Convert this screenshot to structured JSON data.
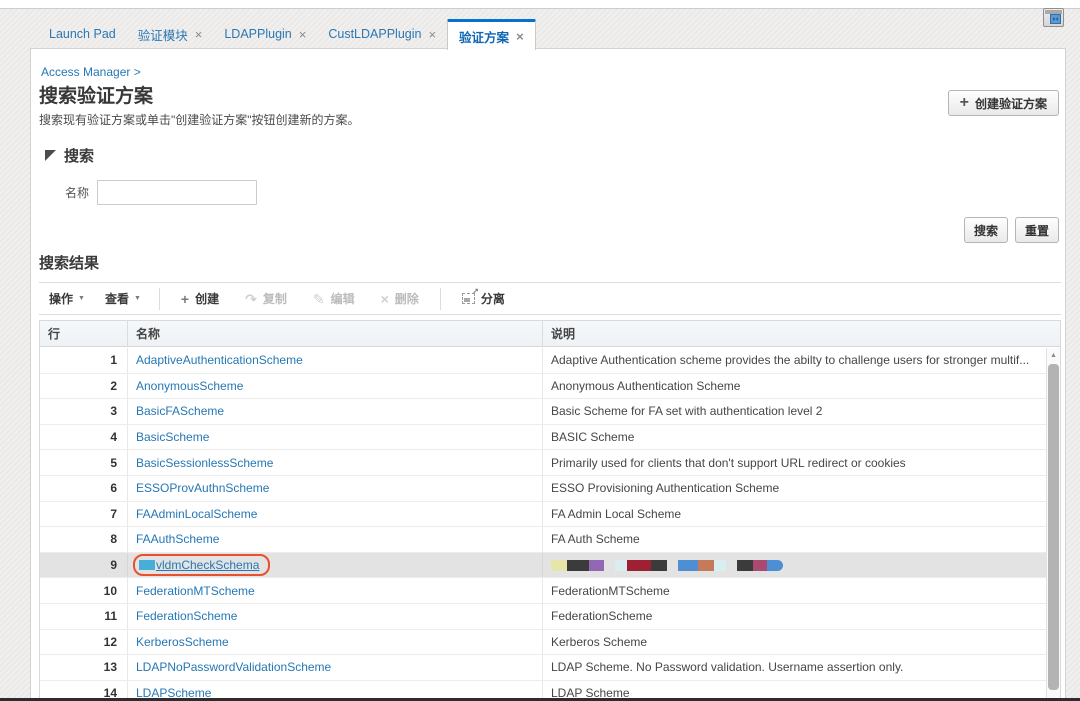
{
  "tabs": [
    {
      "label": "Launch Pad",
      "closable": false,
      "active": false
    },
    {
      "label": "验证模块",
      "closable": true,
      "active": false
    },
    {
      "label": "LDAPPlugin",
      "closable": true,
      "active": false
    },
    {
      "label": "CustLDAPPlugin",
      "closable": true,
      "active": false
    },
    {
      "label": "验证方案",
      "closable": true,
      "active": true
    }
  ],
  "breadcrumb": {
    "label": "Access Manager >"
  },
  "header": {
    "title": "搜索验证方案",
    "subtitle": "搜索现有验证方案或单击\"创建验证方案\"按钮创建新的方案。",
    "create_button": "创建验证方案"
  },
  "search": {
    "section_title": "搜索",
    "name_label": "名称",
    "name_value": "",
    "search_button": "搜索",
    "reset_button": "重置"
  },
  "results": {
    "section_title": "搜索结果",
    "toolbar": {
      "actions": "操作",
      "view": "查看",
      "create": "创建",
      "duplicate": "复制",
      "edit": "编辑",
      "delete": "删除",
      "detach": "分离"
    },
    "columns": {
      "row": "行",
      "name": "名称",
      "description": "说明"
    },
    "rows": [
      {
        "num": "1",
        "name": "AdaptiveAuthenticationScheme",
        "desc": "Adaptive Authentication scheme provides the abilty to challenge users for stronger multif..."
      },
      {
        "num": "2",
        "name": "AnonymousScheme",
        "desc": "Anonymous Authentication Scheme"
      },
      {
        "num": "3",
        "name": "BasicFAScheme",
        "desc": "Basic Scheme for FA set with authentication level 2"
      },
      {
        "num": "4",
        "name": "BasicScheme",
        "desc": "BASIC Scheme"
      },
      {
        "num": "5",
        "name": "BasicSessionlessScheme",
        "desc": "Primarily used for clients that don't support URL redirect or cookies"
      },
      {
        "num": "6",
        "name": "ESSOProvAuthnScheme",
        "desc": "ESSO Provisioning Authentication Scheme"
      },
      {
        "num": "7",
        "name": "FAAdminLocalScheme",
        "desc": "FA Admin Local Scheme"
      },
      {
        "num": "8",
        "name": "FAAuthScheme",
        "desc": "FA Auth Scheme"
      },
      {
        "num": "9",
        "name": "vldmCheckSchema",
        "desc": "",
        "selected": true,
        "annotated": true,
        "underlined": true,
        "name_redact_color": "#47aed8",
        "desc_blocks": [
          [
            {
              "color": "#e6e6a8",
              "w": 16
            },
            {
              "color": "#3b3b3b",
              "w": 22
            },
            {
              "color": "#9268b4",
              "w": 15
            }
          ],
          [
            {
              "color": "#d9eef1",
              "w": 12
            },
            {
              "color": "#9e2033",
              "w": 24
            },
            {
              "color": "#3b3b3b",
              "w": 16
            }
          ],
          [
            {
              "color": "#4e8fd3",
              "w": 20
            },
            {
              "color": "#c57a5c",
              "w": 16
            },
            {
              "color": "#d9eef1",
              "w": 12
            }
          ],
          [
            {
              "color": "#3b3b3b",
              "w": 16
            },
            {
              "color": "#aa4a70",
              "w": 14
            },
            {
              "color": "#4e8fd3",
              "w": 16,
              "rounded": true
            }
          ]
        ]
      },
      {
        "num": "10",
        "name": "FederationMTScheme",
        "desc": "FederationMTScheme"
      },
      {
        "num": "11",
        "name": "FederationScheme",
        "desc": "FederationScheme"
      },
      {
        "num": "12",
        "name": "KerberosScheme",
        "desc": "Kerberos Scheme"
      },
      {
        "num": "13",
        "name": "LDAPNoPasswordValidationScheme",
        "desc": "LDAP Scheme. No Password validation. Username assertion only."
      },
      {
        "num": "14",
        "name": "LDAPScheme",
        "desc": "LDAP Scheme"
      }
    ]
  },
  "colors": {
    "accent_blue": "#0572ce",
    "link": "#2577b5",
    "selected_row": "#e3e3e3",
    "annotation": "#e8502e"
  }
}
